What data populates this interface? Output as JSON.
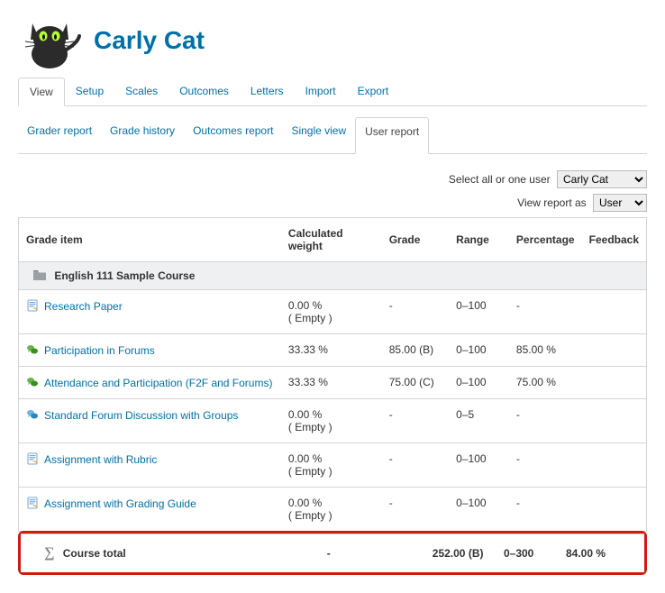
{
  "user_name": "Carly Cat",
  "primary_tabs": [
    "View",
    "Setup",
    "Scales",
    "Outcomes",
    "Letters",
    "Import",
    "Export"
  ],
  "primary_active": 0,
  "secondary_tabs": [
    "Grader report",
    "Grade history",
    "Outcomes report",
    "Single view",
    "User report"
  ],
  "secondary_active": 4,
  "filters": {
    "select_user_label": "Select all or one user",
    "select_user_value": "Carly Cat",
    "view_as_label": "View report as",
    "view_as_value": "User"
  },
  "columns": {
    "name": "Grade item",
    "weight": "Calculated weight",
    "grade": "Grade",
    "range": "Range",
    "percentage": "Percentage",
    "feedback": "Feedback"
  },
  "category": {
    "name": "English 111 Sample Course"
  },
  "items": [
    {
      "icon": "assignment",
      "name": "Research Paper",
      "weight": "0.00 %",
      "weight_note": "( Empty )",
      "grade": "-",
      "range": "0–100",
      "percentage": "-"
    },
    {
      "icon": "forum-green",
      "name": "Participation in Forums",
      "weight": "33.33 %",
      "weight_note": "",
      "grade": "85.00 (B)",
      "range": "0–100",
      "percentage": "85.00 %"
    },
    {
      "icon": "forum-green",
      "name": "Attendance and Participation (F2F and Forums)",
      "weight": "33.33 %",
      "weight_note": "",
      "grade": "75.00 (C)",
      "range": "0–100",
      "percentage": "75.00 %"
    },
    {
      "icon": "forum-blue",
      "name": "Standard Forum Discussion with Groups",
      "weight": "0.00 %",
      "weight_note": "( Empty )",
      "grade": "-",
      "range": "0–5",
      "percentage": "-"
    },
    {
      "icon": "assignment",
      "name": "Assignment with Rubric",
      "weight": "0.00 %",
      "weight_note": "( Empty )",
      "grade": "-",
      "range": "0–100",
      "percentage": "-"
    },
    {
      "icon": "assignment",
      "name": "Assignment with Grading Guide",
      "weight": "0.00 %",
      "weight_note": "( Empty )",
      "grade": "-",
      "range": "0–100",
      "percentage": "-"
    }
  ],
  "total": {
    "label": "Course total",
    "weight": "-",
    "grade": "252.00 (B)",
    "range": "0–300",
    "percentage": "84.00 %"
  }
}
